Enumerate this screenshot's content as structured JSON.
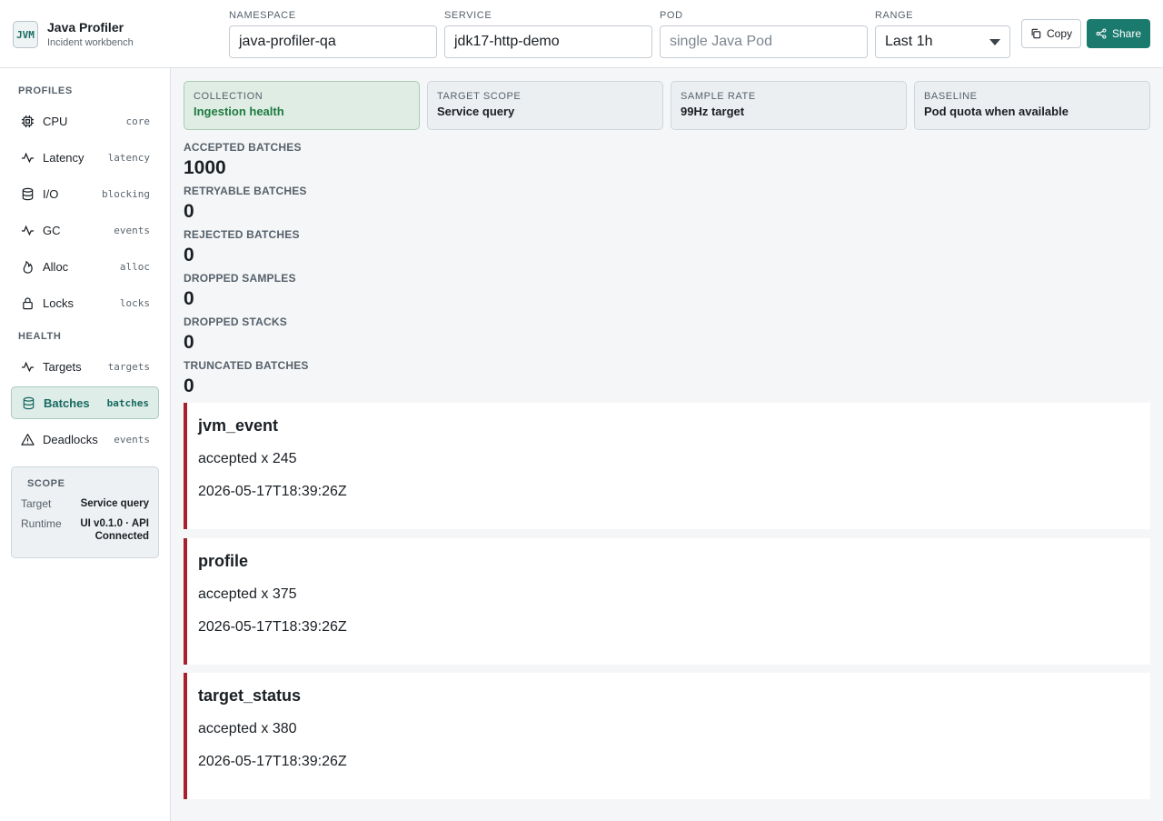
{
  "header": {
    "brand": {
      "logo": "JVM",
      "title": "Java Profiler",
      "subtitle": "Incident workbench"
    },
    "fields": {
      "namespace": {
        "label": "NAMESPACE",
        "value": "java-profiler-qa"
      },
      "service": {
        "label": "SERVICE",
        "value": "jdk17-http-demo"
      },
      "pod": {
        "label": "POD",
        "placeholder": "single Java Pod"
      },
      "range": {
        "label": "RANGE",
        "value": "Last 1h"
      }
    },
    "copy_label": "Copy",
    "share_label": "Share"
  },
  "sidebar": {
    "profiles_label": "PROFILES",
    "health_label": "HEALTH",
    "profiles": [
      {
        "label": "CPU",
        "tag": "core",
        "icon": "cpu-icon"
      },
      {
        "label": "Latency",
        "tag": "latency",
        "icon": "pulse-icon"
      },
      {
        "label": "I/O",
        "tag": "blocking",
        "icon": "database-icon"
      },
      {
        "label": "GC",
        "tag": "events",
        "icon": "pulse-icon"
      },
      {
        "label": "Alloc",
        "tag": "alloc",
        "icon": "flame-icon"
      },
      {
        "label": "Locks",
        "tag": "locks",
        "icon": "lock-icon"
      }
    ],
    "health": [
      {
        "label": "Targets",
        "tag": "targets",
        "icon": "pulse-icon"
      },
      {
        "label": "Batches",
        "tag": "batches",
        "icon": "database-icon",
        "active": true
      },
      {
        "label": "Deadlocks",
        "tag": "events",
        "icon": "warning-icon"
      }
    ],
    "scope": {
      "title": "SCOPE",
      "target_key": "Target",
      "target_value": "Service query",
      "runtime_key": "Runtime",
      "runtime_value_1": "UI v0.1.0 · API",
      "runtime_value_2": "Connected"
    }
  },
  "context_cards": [
    {
      "label": "COLLECTION",
      "value": "Ingestion health",
      "active": true
    },
    {
      "label": "TARGET SCOPE",
      "value": "Service query"
    },
    {
      "label": "SAMPLE RATE",
      "value": "99Hz target"
    },
    {
      "label": "BASELINE",
      "value": "Pod quota when available"
    }
  ],
  "metrics": [
    {
      "label": "ACCEPTED BATCHES",
      "value": "1000"
    },
    {
      "label": "RETRYABLE BATCHES",
      "value": "0"
    },
    {
      "label": "REJECTED BATCHES",
      "value": "0"
    },
    {
      "label": "DROPPED SAMPLES",
      "value": "0"
    },
    {
      "label": "DROPPED STACKS",
      "value": "0"
    },
    {
      "label": "TRUNCATED BATCHES",
      "value": "0"
    }
  ],
  "events": [
    {
      "title": "jvm_event",
      "count": "accepted x 245",
      "time": "2026-05-17T18:39:26Z"
    },
    {
      "title": "profile",
      "count": "accepted x 375",
      "time": "2026-05-17T18:39:26Z"
    },
    {
      "title": "target_status",
      "count": "accepted x 380",
      "time": "2026-05-17T18:39:26Z"
    }
  ],
  "colors": {
    "accent": "#1b7a6e",
    "event_border": "#a5222b",
    "healthy_text": "#1f7a3f"
  }
}
